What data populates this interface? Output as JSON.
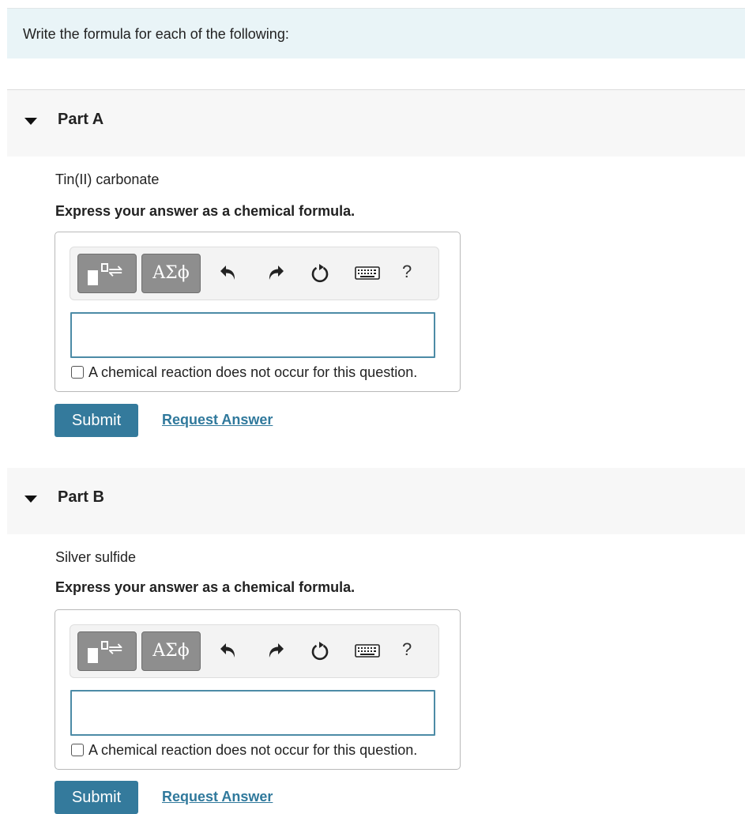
{
  "instructions": "Write the formula for each of the following:",
  "parts": [
    {
      "title": "Part A",
      "question": "Tin(II) carbonate",
      "instruction": "Express your answer as a chemical formula.",
      "input_value": "",
      "symbols_label": "ΑΣϕ",
      "help_label": "?",
      "checkbox_label": "A chemical reaction does not occur for this question.",
      "checkbox_checked": false,
      "submit_label": "Submit",
      "request_label": "Request Answer"
    },
    {
      "title": "Part B",
      "question": "Silver sulfide",
      "instruction": "Express your answer as a chemical formula.",
      "input_value": "",
      "symbols_label": "ΑΣϕ",
      "help_label": "?",
      "checkbox_label": "A chemical reaction does not occur for this question.",
      "checkbox_checked": false,
      "submit_label": "Submit",
      "request_label": "Request Answer"
    }
  ],
  "toolbar_icons": [
    "templates-icon",
    "undo-icon",
    "redo-icon",
    "reset-icon",
    "keyboard-icon",
    "help-icon"
  ],
  "colors": {
    "accent": "#347a9c",
    "link": "#30799c",
    "input_border": "#4c8ba6",
    "intro_bg": "#e9f4f7"
  }
}
